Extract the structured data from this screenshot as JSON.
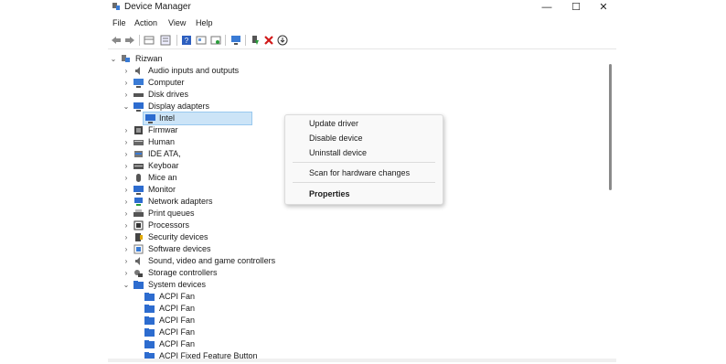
{
  "window": {
    "title": "Device Manager",
    "buttons": {
      "minimize": "—",
      "maximize": "☐",
      "close": "✕"
    }
  },
  "menu": [
    "File",
    "Action",
    "View",
    "Help"
  ],
  "toolbar": [
    "back-icon",
    "forward-icon",
    "properties-grid-icon",
    "device-view-icon",
    "help-icon",
    "resources-icon",
    "details-icon",
    "update-driver-icon",
    "monitor-scan-icon",
    "enable-device-icon",
    "uninstall-icon",
    "disable-device-icon"
  ],
  "tree": {
    "root": "Rizwan",
    "categories": [
      {
        "label": "Audio inputs and outputs",
        "icon": "speaker-icon"
      },
      {
        "label": "Computer",
        "icon": "computer-icon"
      },
      {
        "label": "Disk drives",
        "icon": "disk-icon"
      },
      {
        "label": "Display adapters",
        "icon": "display-icon"
      },
      {
        "label": "Intel",
        "icon": "display-icon"
      },
      {
        "label": "Firmwar",
        "icon": "firmware-icon"
      },
      {
        "label": "Human",
        "icon": "keyboard-icon"
      },
      {
        "label": "IDE ATA,",
        "icon": "ide-icon"
      },
      {
        "label": "Keyboar",
        "icon": "keyboard-icon"
      },
      {
        "label": "Mice an",
        "icon": "mouse-icon"
      },
      {
        "label": "Monitor",
        "icon": "monitor-icon"
      },
      {
        "label": "Network adapters",
        "icon": "network-icon"
      },
      {
        "label": "Print queues",
        "icon": "printer-icon"
      },
      {
        "label": "Processors",
        "icon": "cpu-icon"
      },
      {
        "label": "Security devices",
        "icon": "security-icon"
      },
      {
        "label": "Software devices",
        "icon": "software-icon"
      },
      {
        "label": "Sound, video and game controllers",
        "icon": "speaker-icon"
      },
      {
        "label": "Storage controllers",
        "icon": "storage-icon"
      },
      {
        "label": "System devices",
        "icon": "folder-icon"
      },
      {
        "label": "ACPI Fan",
        "icon": "folder-icon"
      },
      {
        "label": "ACPI Fan",
        "icon": "folder-icon"
      },
      {
        "label": "ACPI Fan",
        "icon": "folder-icon"
      },
      {
        "label": "ACPI Fan",
        "icon": "folder-icon"
      },
      {
        "label": "ACPI Fan",
        "icon": "folder-icon"
      },
      {
        "label": "ACPI Fixed Feature Button",
        "icon": "folder-icon"
      }
    ]
  },
  "context_menu": {
    "items": [
      "Update driver",
      "Disable device",
      "Uninstall device",
      "Scan for hardware changes",
      "Properties"
    ]
  },
  "colors": {
    "selection": "#cce4f7",
    "accent": "#0078d4",
    "delete_red": "#d11a1a",
    "green": "#2a9d3a"
  }
}
